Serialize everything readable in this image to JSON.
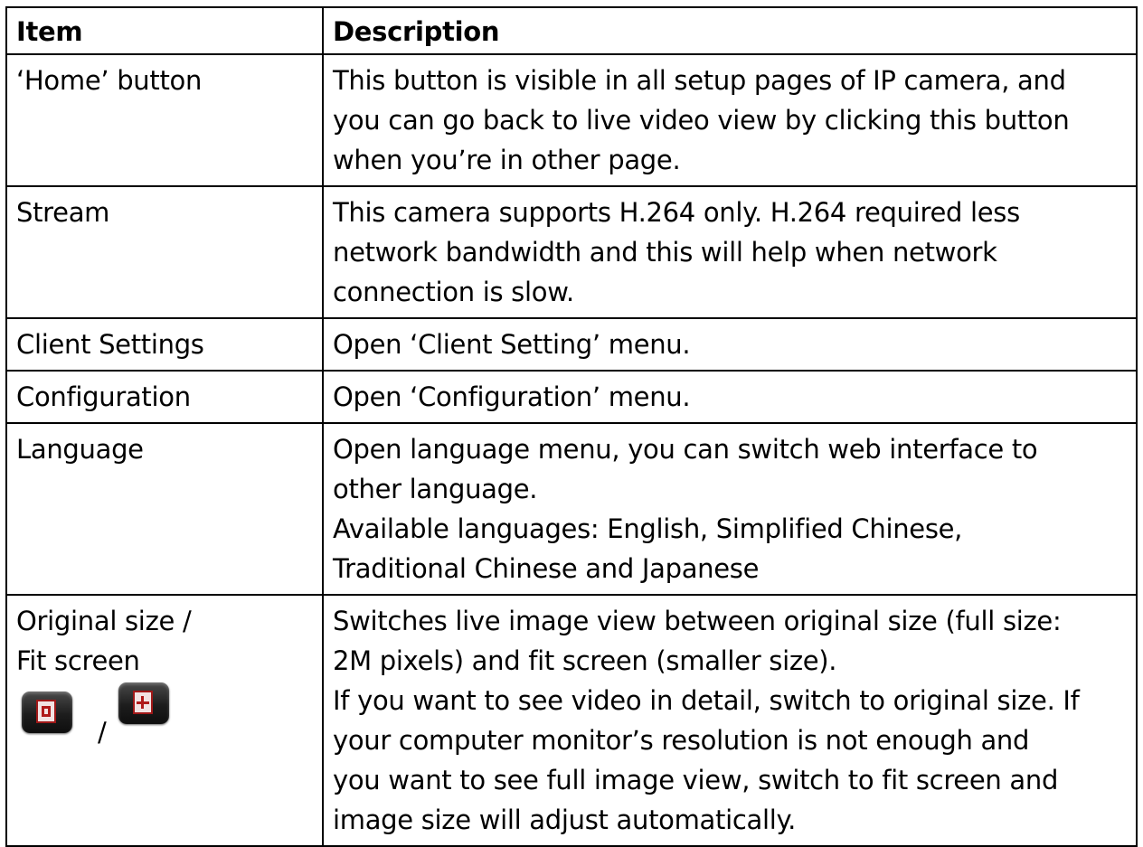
{
  "table": {
    "headers": {
      "item": "Item",
      "description": "Description"
    },
    "rows": [
      {
        "item": [
          "‘Home’ button"
        ],
        "description": [
          "This button is visible in all setup pages of IP camera, and",
          "you can go back to live video view by clicking this button",
          "when you’re in other page."
        ]
      },
      {
        "item": [
          "Stream"
        ],
        "description": [
          "This camera supports H.264 only. H.264 required less",
          "network bandwidth and this will help when network",
          "connection is slow."
        ]
      },
      {
        "item": [
          "Client Settings"
        ],
        "description": [
          "Open ‘Client Setting’ menu."
        ]
      },
      {
        "item": [
          "Configuration"
        ],
        "description": [
          "Open ‘Configuration’ menu."
        ]
      },
      {
        "item": [
          "Language"
        ],
        "description": [
          "Open language menu, you can switch web interface to",
          "other language.",
          "Available languages: English, Simplified Chinese,",
          "Traditional Chinese and Japanese"
        ]
      },
      {
        "item": [
          "Original size /",
          "Fit screen"
        ],
        "icon_separator": "/",
        "icons": [
          "original-size-icon",
          "fit-screen-icon"
        ],
        "description": [
          "Switches live image view between original size (full size:",
          "2M pixels) and fit screen (smaller size).",
          "If you want to see video in detail, switch to original size. If",
          "your computer monitor’s resolution is not enough and",
          "you want to see full image view, switch to fit screen and",
          "image size will adjust automatically."
        ]
      }
    ]
  }
}
